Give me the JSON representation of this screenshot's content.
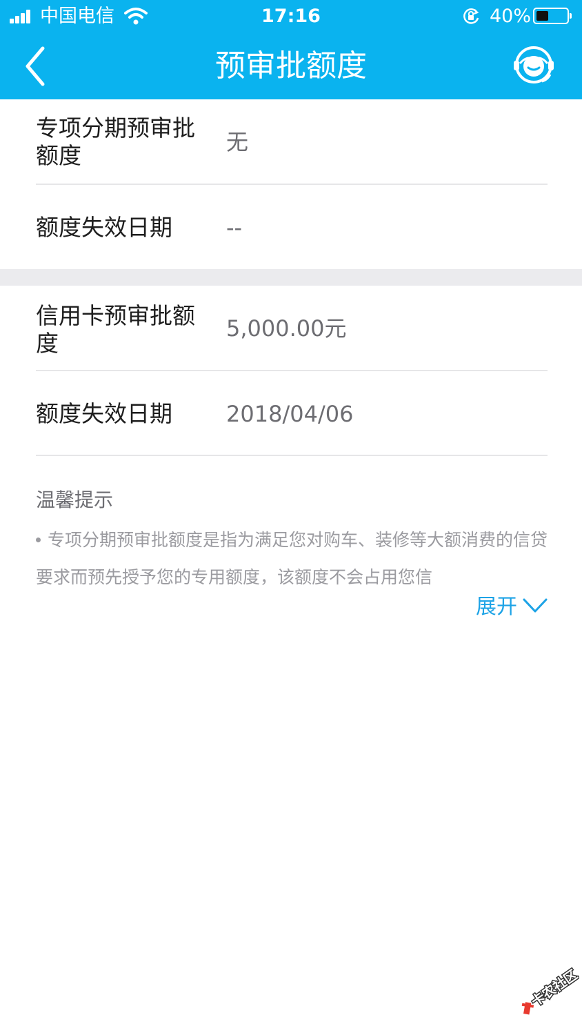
{
  "status_bar": {
    "carrier": "中国电信",
    "time": "17:16",
    "battery_percent": "40%",
    "battery_level": 0.4
  },
  "header": {
    "title": "预审批额度",
    "back_icon": "chevron-left-icon",
    "service_icon": "customer-service-icon"
  },
  "sections": [
    {
      "rows": [
        {
          "label": "专项分期预审批额度",
          "value": "无"
        },
        {
          "label": "额度失效日期",
          "value": "--"
        }
      ]
    },
    {
      "rows": [
        {
          "label": "信用卡预审批额度",
          "value": "5,000.00元"
        },
        {
          "label": "额度失效日期",
          "value": "2018/04/06"
        }
      ]
    }
  ],
  "tips": {
    "title": "温馨提示",
    "text": "专项分期预审批额度是指为满足您对购车、装修等大额消费的信贷要求而预先授予您的专用额度，该额度不会占用您信",
    "expand_label": "展开"
  },
  "watermark": {
    "text": "卡农社区"
  },
  "colors": {
    "header": "#0ab3ef",
    "link": "#1da3e6",
    "divider": "#e6e6e8",
    "section_gap": "#ebebee"
  }
}
